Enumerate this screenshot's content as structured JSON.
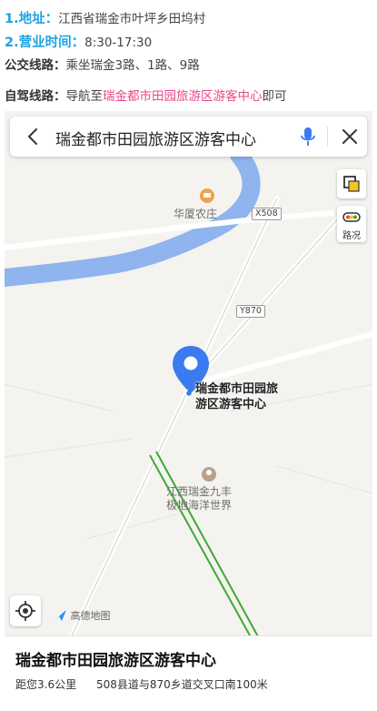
{
  "info": {
    "address_label": "1.地址：",
    "address_value": "江西省瑞金市叶坪乡田坞村",
    "hours_label": "2.营业时间：",
    "hours_value": "8:30-17:30",
    "bus_label": "公交线路：",
    "bus_value": "乘坐瑞金3路、1路、9路",
    "drive_label": "自驾线路：",
    "drive_prefix": "导航至",
    "drive_destination": "瑞金都市田园旅游区游客中心",
    "drive_suffix": "即可"
  },
  "map": {
    "search_query": "瑞金都市田园旅游区游客中心",
    "traffic_label": "路况",
    "poi_farm": "华厦农庄",
    "poi_ocean_line1": "江西瑞金九丰",
    "poi_ocean_line2": "极地海洋世界",
    "road_x508": "X508",
    "road_y870": "Y870",
    "destination_line1": "瑞金都市田园旅",
    "destination_line2": "游区游客中心",
    "brand": "高德地图"
  },
  "card": {
    "name": "瑞金都市田园旅游区游客中心",
    "distance": "距您3.6公里",
    "address": "508县道与870乡道交叉口南100米"
  },
  "colors": {
    "label_blue": "#1fa2e0",
    "highlight_pink": "#e8478b",
    "pin_blue": "#3a7bf0",
    "river_blue": "#8fb4ee",
    "rail_green": "#3da836"
  }
}
